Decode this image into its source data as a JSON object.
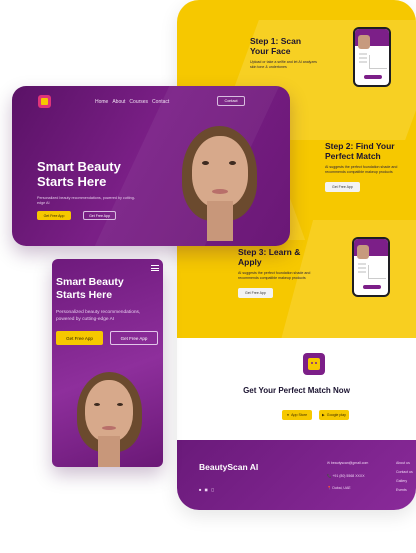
{
  "colors": {
    "purple": "#7c1f88",
    "yellow": "#f6c800",
    "magenta": "#e0347a"
  },
  "desktop": {
    "nav": [
      "Home",
      "About",
      "Courses",
      "Contact"
    ],
    "contact_button": "Contact",
    "hero_title": "Smart Beauty Starts Here",
    "hero_sub": "Personalized beauty recommendations, powered by cutting-edge AI",
    "primary_button": "Get Free App",
    "secondary_button": "Get Free App"
  },
  "mobile": {
    "hero_title": "Smart Beauty Starts Here",
    "hero_sub": "Personalized beauty recommendations, powered by cutting-edge AI",
    "primary_button": "Get Free App",
    "secondary_button": "Get Free App"
  },
  "steps": [
    {
      "title": "Step 1: Scan Your Face",
      "text": "Upload or take a selfie and let AI analyzes skin tone & undertones",
      "button": ""
    },
    {
      "title": "Step 2: Find Your Perfect Match",
      "text": "AI suggests the perfect foundation shade and recommends compatible makeup products",
      "button": "Get Free App"
    },
    {
      "title": "Step 3: Learn & Apply",
      "text": "AI suggests the perfect foundation shade and recommends compatible makeup products",
      "button": "Get Free App"
    }
  ],
  "cta": {
    "title": "Get Your Perfect Match Now",
    "app_store": "App Store",
    "google_play": "Google play"
  },
  "footer": {
    "brand": "BeautyScan AI",
    "email": "✉ beautyscan@gmail.com",
    "phone": "📞 +91 (80) 5568 XXXX",
    "location": "📍 Dubai, UAE",
    "links": [
      "About us",
      "Contact us",
      "Gallery",
      "Events"
    ]
  }
}
